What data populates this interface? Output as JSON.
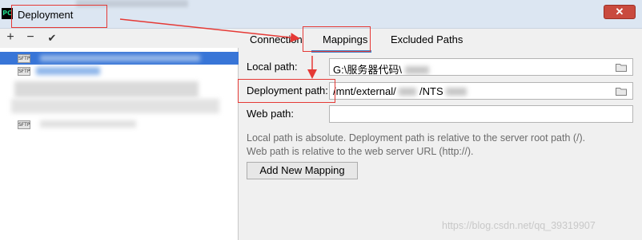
{
  "window": {
    "title": "Deployment",
    "app_icon_text": "PC",
    "close_glyph": "✕"
  },
  "toolbar": {
    "add_glyph": "+",
    "remove_glyph": "−",
    "check_glyph": "✔"
  },
  "servers": [
    {
      "icon_label": "SFTP"
    },
    {
      "icon_label": "SFTP"
    },
    {
      "icon_label": "SFTP"
    }
  ],
  "tabs": {
    "connection": "Connection",
    "mappings": "Mappings",
    "excluded": "Excluded Paths"
  },
  "mappings": {
    "local_path_label": "Local path:",
    "local_path_value": "G:\\服务器代码\\",
    "deployment_path_label": "Deployment path:",
    "deployment_path_value": "/mnt/external/",
    "deployment_path_suffix": "/NTS",
    "web_path_label": "Web path:",
    "web_path_value": "",
    "help_line1": "Local path is absolute. Deployment path is relative to the server root path (/).",
    "help_line2": "Web path is relative to the web server URL (http://).",
    "add_button": "Add New Mapping"
  },
  "watermark": "https://blog.csdn.net/qq_39319907",
  "colors": {
    "annotation": "#e53935",
    "selection": "#3875d7",
    "tab_underline": "#4083c9"
  }
}
